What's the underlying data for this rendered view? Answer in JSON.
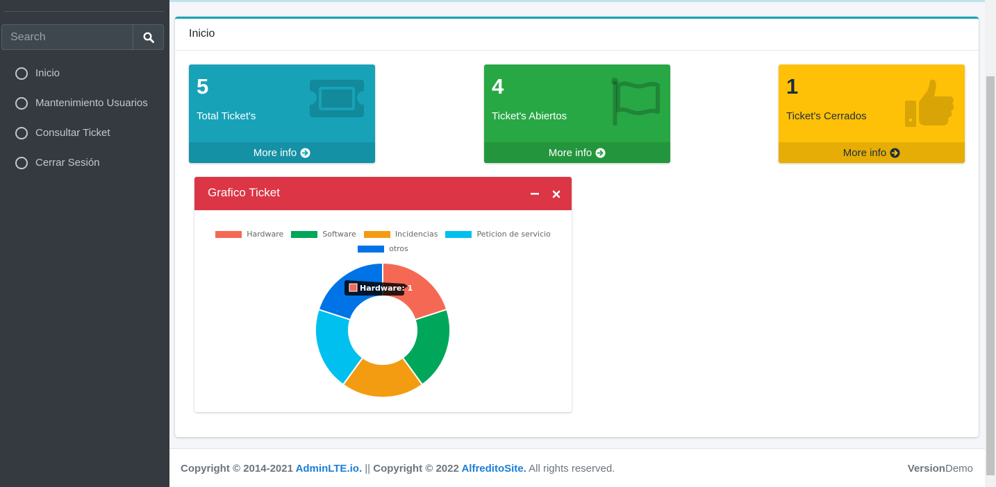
{
  "sidebar": {
    "search": {
      "placeholder": "Search"
    },
    "items": [
      {
        "label": "Inicio"
      },
      {
        "label": "Mantenimiento Usuarios"
      },
      {
        "label": "Consultar Ticket"
      },
      {
        "label": "Cerrar Sesión"
      }
    ]
  },
  "main": {
    "title": "Inicio",
    "boxes": [
      {
        "value": "5",
        "label": "Total Ticket's",
        "more": "More info",
        "icon": "ticket-icon",
        "color": "#17a2b8"
      },
      {
        "value": "4",
        "label": "Ticket's Abiertos",
        "more": "More info",
        "icon": "flag-icon",
        "color": "#28a745"
      },
      {
        "value": "1",
        "label": "Ticket's Cerrados",
        "more": "More info",
        "icon": "thumbs-up-icon",
        "color": "#ffc107"
      }
    ],
    "chart_card": {
      "title": "Grafico Ticket",
      "tooltip": "Hardware: 1"
    }
  },
  "chart_data": {
    "type": "pie",
    "categories": [
      "Hardware",
      "Software",
      "Incidencias",
      "Peticion de servicio",
      "otros"
    ],
    "values": [
      1,
      1,
      1,
      1,
      1
    ],
    "colors": [
      "#f56954",
      "#00a65a",
      "#f39c12",
      "#00c0ef",
      "#0073e6"
    ],
    "donut": true,
    "legend": "top"
  },
  "footer": {
    "copy1": "Copyright © 2014-2021 ",
    "link1": "AdminLTE.io.",
    "sep": " || ",
    "copy2": "Copyright © 2022 ",
    "link2": "AlfreditoSite.",
    "rights": " All rights reserved.",
    "version_label": "Version",
    "version_value": "Demo"
  }
}
